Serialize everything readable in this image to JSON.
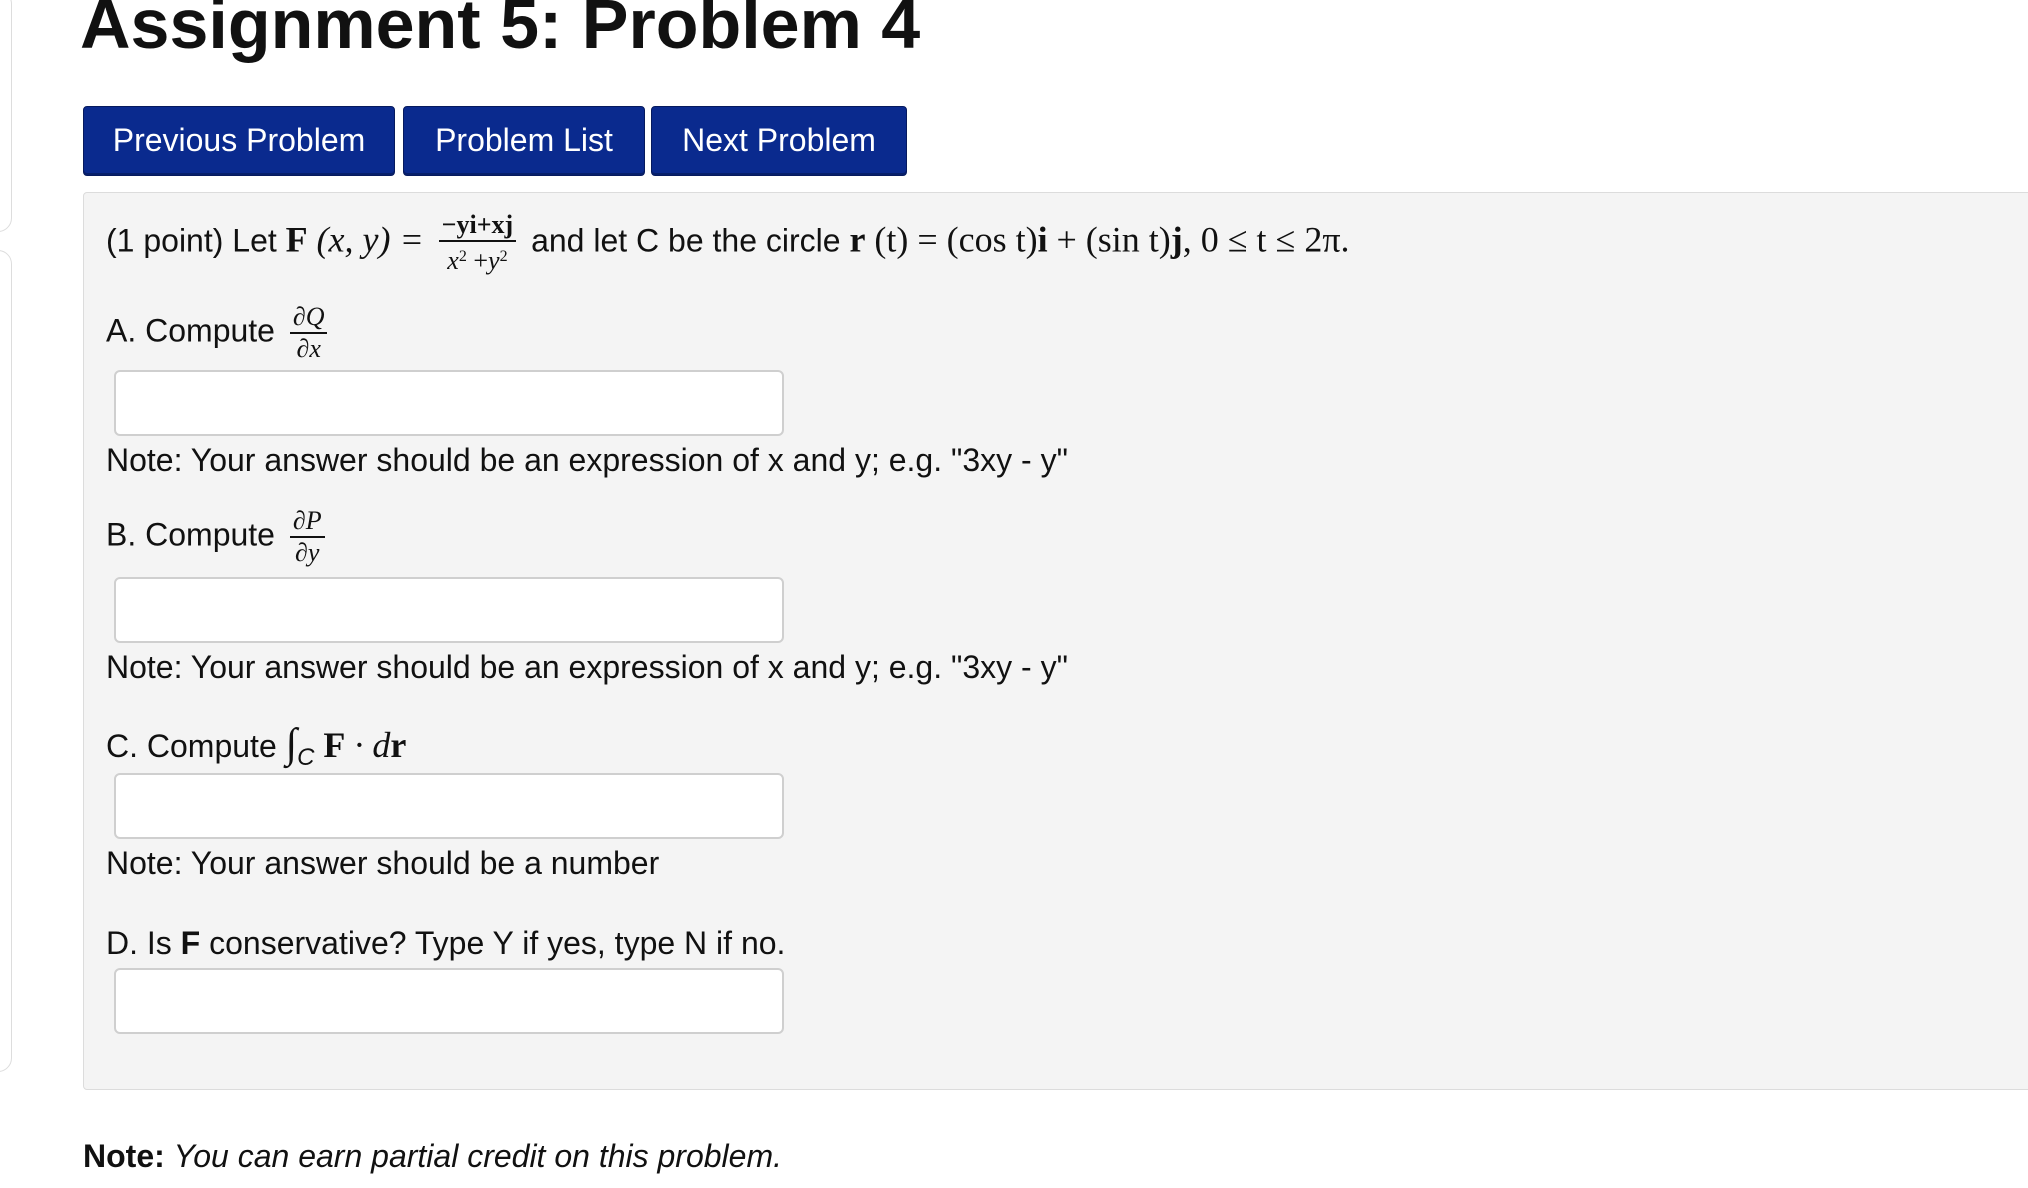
{
  "header": {
    "title": "Assignment 5: Problem 4"
  },
  "nav": {
    "previous_label": "Previous Problem",
    "list_label": "Problem List",
    "next_label": "Next Problem"
  },
  "problem": {
    "points": "(1 point)",
    "let_text": "Let",
    "F_symbol": "F",
    "F_args": "(x, y) =",
    "fraction_num": "−yi+xj",
    "fraction_den_x": "x",
    "fraction_den_plus": " +",
    "fraction_den_y": "y",
    "sq": "2",
    "circle_text": "and let C be the circle",
    "r_symbol": "r",
    "r_expr": "(t) = (cos t)",
    "i_unit": "i",
    "plus_sin": "+ (sin t)",
    "j_unit": "j",
    "range": ", 0 ≤ t ≤ 2π."
  },
  "parts": {
    "a": {
      "label": "A. Compute",
      "num": "∂Q",
      "den": "∂x",
      "answer": "",
      "note": "Note: Your answer should be an expression of x and y; e.g. \"3xy - y\""
    },
    "b": {
      "label": "B. Compute",
      "num": "∂P",
      "den": "∂y",
      "answer": "",
      "note": "Note: Your answer should be an expression of x and y; e.g. \"3xy - y\""
    },
    "c": {
      "label": "C. Compute",
      "integral": "∫",
      "sub": "C",
      "F": "F",
      "dot_d": " · d",
      "r": "r",
      "answer": "",
      "note": "Note: Your answer should be a number"
    },
    "d": {
      "label_pre": "D. Is ",
      "F": "F",
      "label_post": " conservative? Type Y if yes, type N if no.",
      "answer": ""
    }
  },
  "footer": {
    "note_label": "Note:",
    "note_text": "You can earn partial credit on this problem."
  }
}
